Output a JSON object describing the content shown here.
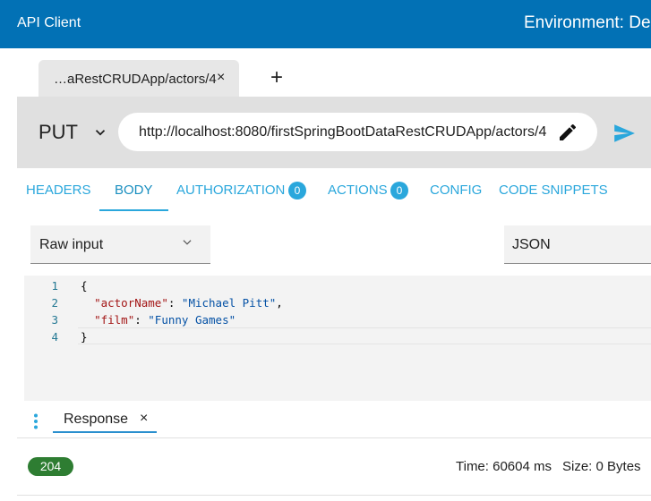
{
  "header": {
    "app_title": "API Client",
    "environment": "Environment: De"
  },
  "request_tabs": {
    "active_tab_label": "…aRestCRUDApp/actors/4",
    "close_glyph": "×",
    "add_glyph": "+"
  },
  "request": {
    "method": "PUT",
    "url": "http://localhost:8080/firstSpringBootDataRestCRUDApp/actors/4",
    "icons": [
      "chevron-down-icon",
      "pencil-icon",
      "send-icon"
    ]
  },
  "tabs": [
    {
      "label": "HEADERS",
      "active": false
    },
    {
      "label": "BODY",
      "active": true
    },
    {
      "label": "AUTHORIZATION",
      "badge": "0",
      "active": false
    },
    {
      "label": "ACTIONS",
      "badge": "0",
      "active": false
    },
    {
      "label": "CONFIG",
      "active": false
    },
    {
      "label": "CODE SNIPPETS",
      "active": false
    }
  ],
  "body_options": {
    "input_type": "Raw input",
    "format": "JSON"
  },
  "editor": {
    "line_numbers": [
      "1",
      "2",
      "3",
      "4"
    ],
    "lines": [
      {
        "open": "{"
      },
      {
        "key": "\"actorName\"",
        "sep": ": ",
        "value": "\"Michael Pitt\"",
        "trail": ","
      },
      {
        "key": "\"film\"",
        "sep": ": ",
        "value": "\"Funny Games\"",
        "trail": ""
      },
      {
        "close": "}"
      }
    ]
  },
  "response": {
    "tab_label": "Response",
    "close_glyph": "×",
    "status_code": "204",
    "time": "Time: 60604 ms",
    "size": "Size: 0 Bytes"
  },
  "colors": {
    "header_bg": "#0271b5",
    "tab_accent": "#2aa7dc",
    "status_ok": "#2e7d32",
    "json_key": "#a31515",
    "json_string": "#0451a5"
  }
}
